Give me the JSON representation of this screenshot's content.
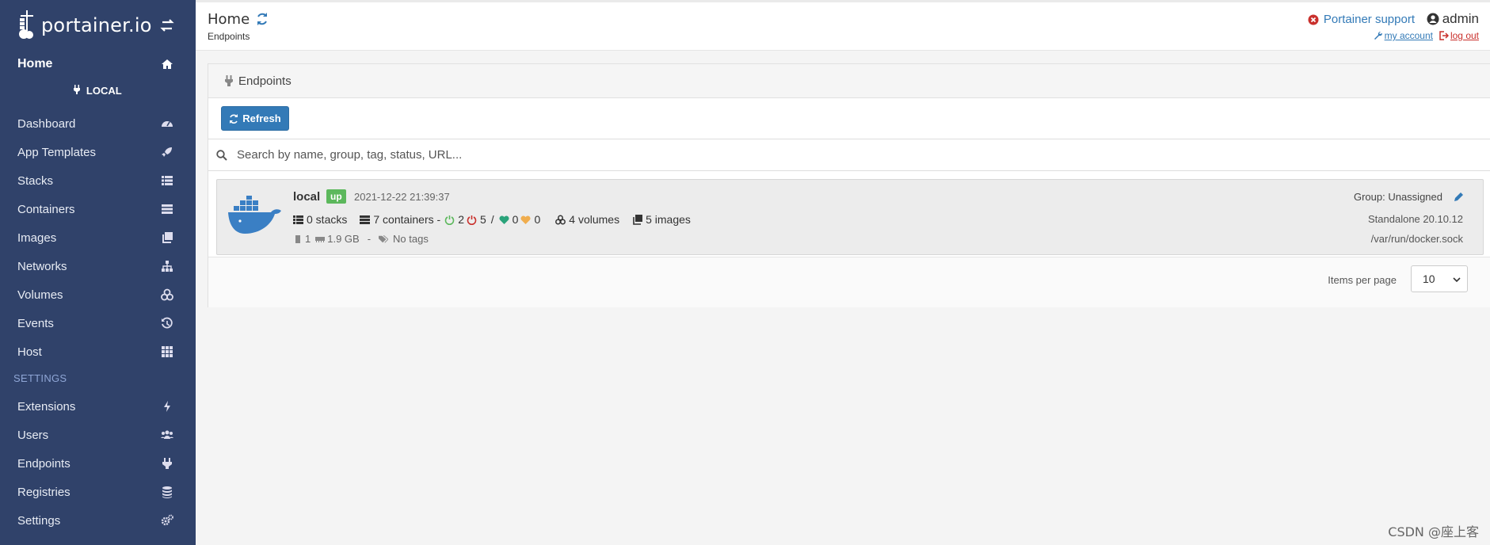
{
  "brand": {
    "name": "portainer.io"
  },
  "sidebar": {
    "home_label": "Home",
    "environment_label": "LOCAL",
    "items": [
      {
        "label": "Dashboard",
        "icon": "tachometer-icon"
      },
      {
        "label": "App Templates",
        "icon": "rocket-icon"
      },
      {
        "label": "Stacks",
        "icon": "th-list-icon"
      },
      {
        "label": "Containers",
        "icon": "server-icon"
      },
      {
        "label": "Images",
        "icon": "clone-icon"
      },
      {
        "label": "Networks",
        "icon": "sitemap-icon"
      },
      {
        "label": "Volumes",
        "icon": "cubes-icon"
      },
      {
        "label": "Events",
        "icon": "history-icon"
      },
      {
        "label": "Host",
        "icon": "th-icon"
      }
    ],
    "settings_section_title": "SETTINGS",
    "settings_items": [
      {
        "label": "Extensions",
        "icon": "bolt-icon"
      },
      {
        "label": "Users",
        "icon": "users-icon"
      },
      {
        "label": "Endpoints",
        "icon": "plug-icon"
      },
      {
        "label": "Registries",
        "icon": "database-icon"
      },
      {
        "label": "Settings",
        "icon": "cogs-icon"
      }
    ]
  },
  "header": {
    "title": "Home",
    "breadcrumb": "Endpoints",
    "support_label": "Portainer support",
    "username": "admin",
    "my_account_label": "my account",
    "logout_label": "log out"
  },
  "endpoints_widget": {
    "title": "Endpoints",
    "refresh_label": "Refresh",
    "search_placeholder": "Search by name, group, tag, status, URL...",
    "items": [
      {
        "name": "local",
        "status": "up",
        "timestamp": "2021-12-22 21:39:37",
        "stacks": "0 stacks",
        "containers": "7 containers -",
        "running": "2",
        "stopped": "5",
        "separator": "/",
        "healthy": "0",
        "unhealthy": "0",
        "volumes": "4 volumes",
        "images": "5 images",
        "cpu": "1",
        "memory": "1.9 GB",
        "meta_separator": "-",
        "tags": "No tags",
        "group": "Group: Unassigned",
        "engine": "Standalone 20.10.12",
        "url": "/var/run/docker.sock"
      }
    ],
    "items_per_page_label": "Items per page",
    "items_per_page_value": "10"
  },
  "watermark": "CSDN @座上客",
  "colors": {
    "sidebar_bg": "#30426a",
    "primary": "#337ab7",
    "success": "#5cb85c",
    "danger": "#c9302c"
  }
}
